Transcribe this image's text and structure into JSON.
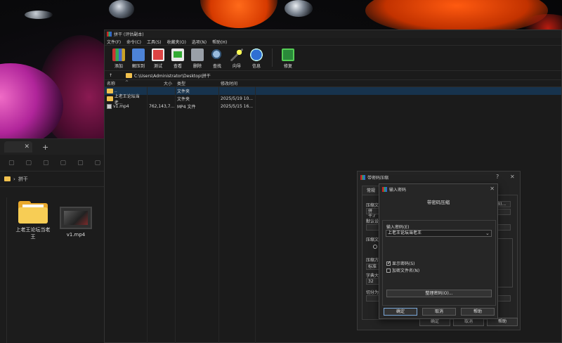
{
  "explorer": {
    "close_glyph": "✕",
    "newtab_glyph": "+",
    "breadcrumb_sep": "›",
    "breadcrumb": "拼干",
    "tiles": [
      {
        "label": "上老王论坛当老王",
        "type": "folder"
      },
      {
        "label": "v1.mp4",
        "type": "video"
      }
    ]
  },
  "winrar": {
    "title": "拼干 (评估副本)",
    "menu": [
      "文件(F)",
      "命令(C)",
      "工具(S)",
      "收藏夹(O)",
      "选项(N)",
      "帮助(H)"
    ],
    "toolbar": [
      {
        "label": "添加",
        "icon": "add-icon"
      },
      {
        "label": "解压到",
        "icon": "extract-icon"
      },
      {
        "label": "测试",
        "icon": "test-icon"
      },
      {
        "label": "查看",
        "icon": "view-icon"
      },
      {
        "label": "删除",
        "icon": "delete-icon"
      },
      {
        "label": "查找",
        "icon": "find-icon"
      },
      {
        "label": "向导",
        "icon": "wizard-icon"
      },
      {
        "label": "信息",
        "icon": "info-icon"
      },
      {
        "label": "修复",
        "icon": "repair-icon"
      }
    ],
    "up_glyph": "↑",
    "path": "C:\\Users\\Administrator\\Desktop\\拼干",
    "columns": {
      "name": "名称",
      "size": "大小",
      "type": "类型",
      "modified": "修改时间",
      "sort_glyph": "^"
    },
    "files": [
      {
        "name": "..",
        "size": "",
        "type": "文件夹",
        "modified": "",
        "selected": true
      },
      {
        "name": "上老王论坛当老...",
        "size": "",
        "type": "文件夹",
        "modified": "2025/5/19 10...",
        "selected": false
      },
      {
        "name": "v1.mp4",
        "size": "762,143,7...",
        "type": "MP4 文件",
        "modified": "2025/5/15 16...",
        "selected": false
      }
    ]
  },
  "archive_dialog": {
    "title": "带密码压缩",
    "help_glyph": "?",
    "close_glyph": "✕",
    "tabs": [
      "常规",
      "高"
    ],
    "labels": {
      "archive_name": "压缩文",
      "archive_name_value": "拼干.r",
      "default": "默认设",
      "format": "压缩文",
      "method": "压缩方",
      "method_value": "标准",
      "dict": "字典大",
      "dict_value": "32",
      "split": "切分为"
    },
    "browse_label": "B)...",
    "buttons": {
      "ok": "确定",
      "cancel": "取消",
      "help": "帮助"
    }
  },
  "password_dialog": {
    "title": "输入密码",
    "close_glyph": "✕",
    "heading": "带密码压缩",
    "password_label": "输入密码(E)",
    "password_value": "上老王论坛当老王",
    "dropdown_glyph": "⌄",
    "show_password": {
      "label": "显示密码(S)",
      "checked": true
    },
    "encrypt_names": {
      "label": "加密文件名(N)",
      "checked": false
    },
    "organize_button": "整理密码(O)...",
    "buttons": {
      "ok": "确定",
      "cancel": "取消",
      "help": "帮助"
    }
  }
}
